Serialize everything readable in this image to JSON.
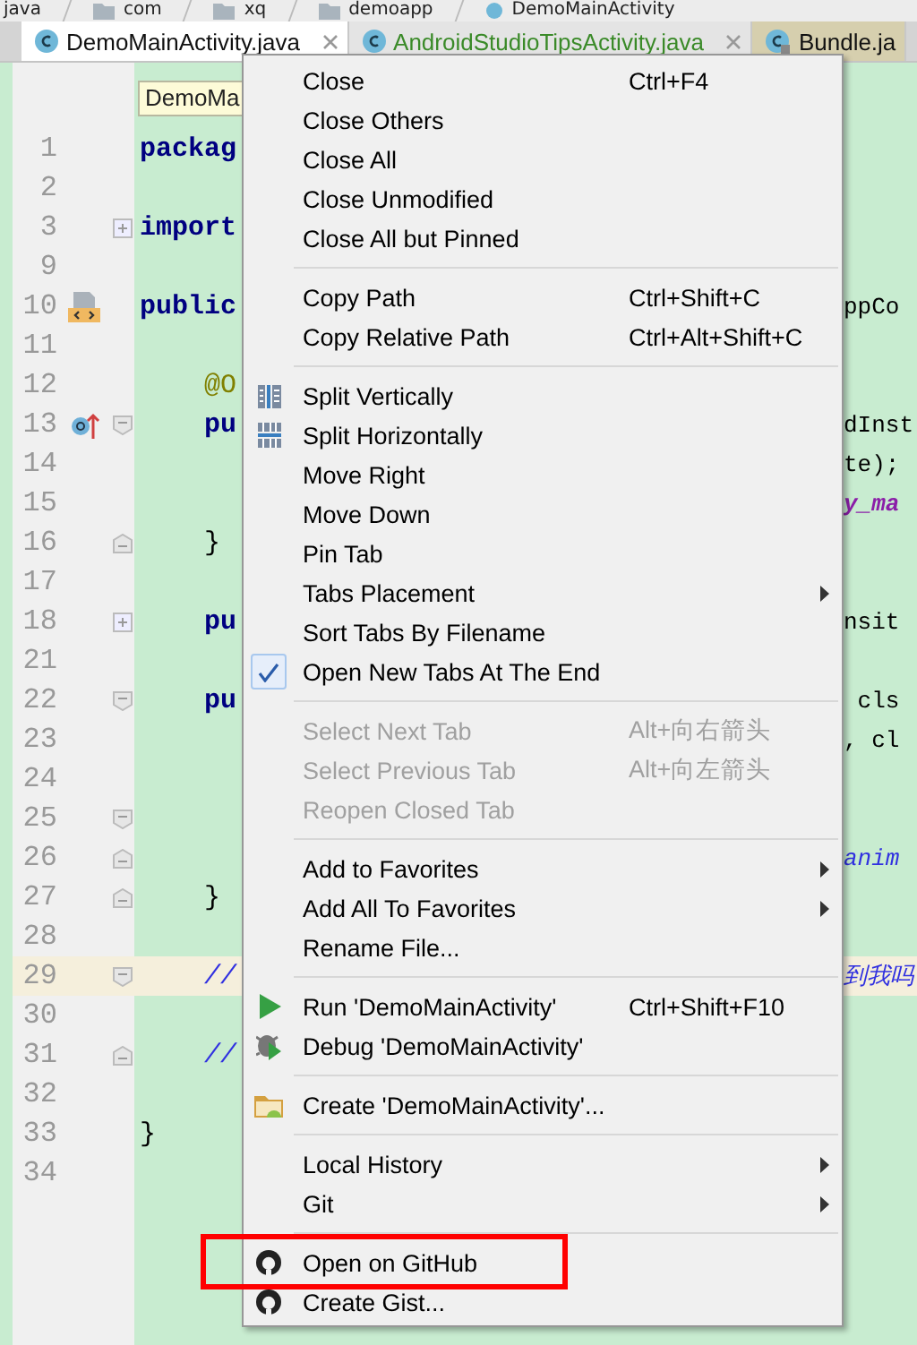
{
  "breadcrumbs": [
    {
      "label": "java",
      "kind": "module"
    },
    {
      "label": "com",
      "kind": "package"
    },
    {
      "label": "xq",
      "kind": "package"
    },
    {
      "label": "demoapp",
      "kind": "package"
    },
    {
      "label": "DemoMainActivity",
      "kind": "class"
    }
  ],
  "tabs": [
    {
      "label": "DemoMainActivity.java",
      "selected": true,
      "modified": false,
      "library": false,
      "closable": true
    },
    {
      "label": "AndroidStudioTipsActivity.java",
      "selected": false,
      "modified": true,
      "library": false,
      "closable": true
    },
    {
      "label": "Bundle.ja",
      "selected": false,
      "modified": false,
      "library": true,
      "closable": false
    }
  ],
  "tooltip": "DemoMa",
  "editor": {
    "lines": [
      {
        "number": "1",
        "left": {
          "text": "packag",
          "kind": "keyword"
        }
      },
      {
        "number": "2"
      },
      {
        "number": "3",
        "folded": true,
        "left": {
          "text": "import",
          "kind": "keyword"
        }
      },
      {
        "number": "9"
      },
      {
        "number": "10",
        "implemented": true,
        "left": {
          "text": "public",
          "kind": "keyword"
        },
        "right": {
          "text": "ppCo",
          "kind": "plain"
        }
      },
      {
        "number": "11"
      },
      {
        "number": "12",
        "left": {
          "text": "    @O",
          "kind": "annotation"
        }
      },
      {
        "number": "13",
        "overrides": true,
        "fold_start": true,
        "left": {
          "text": "    pu",
          "kind": "keyword"
        },
        "right": {
          "text": "dInst",
          "kind": "plain"
        }
      },
      {
        "number": "14",
        "right": {
          "text": "te);",
          "kind": "plain"
        }
      },
      {
        "number": "15",
        "right": {
          "text": "y_ma",
          "kind": "field"
        }
      },
      {
        "number": "16",
        "fold_end": true,
        "left": {
          "text": "    }",
          "kind": "plain"
        }
      },
      {
        "number": "17"
      },
      {
        "number": "18",
        "folded": true,
        "left": {
          "text": "    pu",
          "kind": "keyword"
        },
        "right": {
          "text": "nsit",
          "kind": "plain"
        }
      },
      {
        "number": "21"
      },
      {
        "number": "22",
        "fold_start": true,
        "left": {
          "text": "    pu",
          "kind": "keyword"
        },
        "right": {
          "text": " cls",
          "kind": "plain"
        }
      },
      {
        "number": "23",
        "right": {
          "text": ", cl",
          "kind": "plain"
        }
      },
      {
        "number": "24"
      },
      {
        "number": "25",
        "fold_start": true
      },
      {
        "number": "26",
        "fold_end": true,
        "right": {
          "text": "anim",
          "kind": "comment"
        }
      },
      {
        "number": "27",
        "fold_end": true,
        "left": {
          "text": "    }",
          "kind": "plain"
        }
      },
      {
        "number": "28"
      },
      {
        "number": "29",
        "current": true,
        "fold_start": true,
        "left": {
          "text": "    //",
          "kind": "comment"
        },
        "right": {
          "text": "到我吗",
          "kind": "comment"
        }
      },
      {
        "number": "30"
      },
      {
        "number": "31",
        "fold_end": true,
        "left": {
          "text": "    //",
          "kind": "comment"
        }
      },
      {
        "number": "32"
      },
      {
        "number": "33",
        "left": {
          "text": "}",
          "kind": "plain"
        }
      },
      {
        "number": "34"
      }
    ]
  },
  "context_menu": {
    "groups": [
      [
        {
          "label": "Close",
          "shortcut": "Ctrl+F4",
          "kind": "command"
        },
        {
          "label": "Close Others",
          "kind": "command"
        },
        {
          "label": "Close All",
          "kind": "command"
        },
        {
          "label": "Close Unmodified",
          "kind": "command"
        },
        {
          "label": "Close All but Pinned",
          "kind": "command"
        }
      ],
      [
        {
          "label": "Copy Path",
          "shortcut": "Ctrl+Shift+C",
          "kind": "command"
        },
        {
          "label": "Copy Relative Path",
          "shortcut": "Ctrl+Alt+Shift+C",
          "kind": "command"
        }
      ],
      [
        {
          "label": "Split Vertically",
          "kind": "vsplit"
        },
        {
          "label": "Split Horizontally",
          "kind": "hsplit"
        },
        {
          "label": "Move Right",
          "kind": "command"
        },
        {
          "label": "Move Down",
          "kind": "command"
        },
        {
          "label": "Pin Tab",
          "kind": "command"
        },
        {
          "label": "Tabs Placement",
          "submenu": true,
          "kind": "command"
        },
        {
          "label": "Sort Tabs By Filename",
          "kind": "command"
        },
        {
          "label": "Open New Tabs At The End",
          "checked": true,
          "kind": "command"
        }
      ],
      [
        {
          "label": "Select Next Tab",
          "shortcut": "Alt+向右箭头",
          "disabled": true,
          "kind": "command"
        },
        {
          "label": "Select Previous Tab",
          "shortcut": "Alt+向左箭头",
          "disabled": true,
          "kind": "command"
        },
        {
          "label": "Reopen Closed Tab",
          "disabled": true,
          "kind": "command"
        }
      ],
      [
        {
          "label": "Add to Favorites",
          "submenu": true,
          "kind": "command"
        },
        {
          "label": "Add All To Favorites",
          "submenu": true,
          "kind": "command"
        },
        {
          "label": "Rename File...",
          "kind": "command"
        }
      ],
      [
        {
          "label": "Run 'DemoMainActivity'",
          "shortcut": "Ctrl+Shift+F10",
          "kind": "run"
        },
        {
          "label": "Debug 'DemoMainActivity'",
          "kind": "debug"
        }
      ],
      [
        {
          "label": "Create 'DemoMainActivity'...",
          "kind": "create"
        }
      ],
      [
        {
          "label": "Local History",
          "submenu": true,
          "kind": "command"
        },
        {
          "label": "Git",
          "submenu": true,
          "kind": "command"
        }
      ],
      [
        {
          "label": "Open on GitHub",
          "kind": "github",
          "highlighted": true
        },
        {
          "label": "Create Gist...",
          "kind": "github"
        }
      ]
    ]
  }
}
